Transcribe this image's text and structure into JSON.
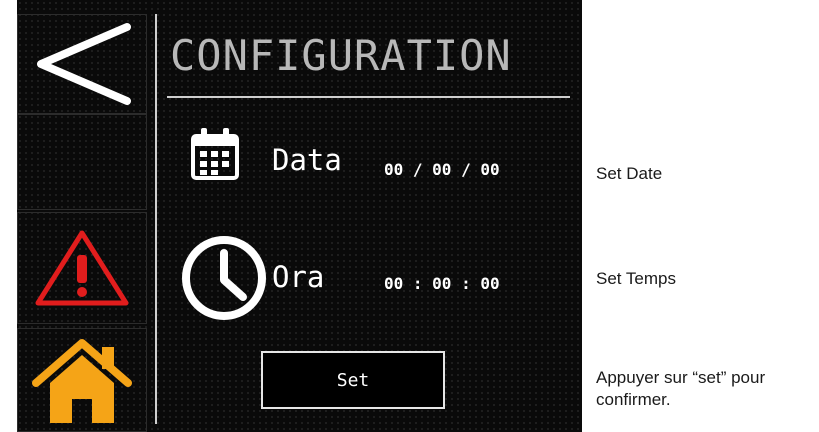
{
  "screen": {
    "title": "CONFIGURATION",
    "date_label": "Data",
    "date_value": "00 / 00 / 00",
    "time_label": "Ora",
    "time_value": "00 : 00 : 00",
    "set_button": "Set"
  },
  "sidebar": {
    "items": [
      {
        "icon": "back-arrow-icon"
      },
      {
        "icon": "empty"
      },
      {
        "icon": "warning-icon"
      },
      {
        "icon": "home-icon"
      }
    ]
  },
  "notes": {
    "set_date": "Set Date",
    "set_time": "Set Temps",
    "confirm_line1": "Appuyer sur “set” pour",
    "confirm_line2": "confirmer."
  },
  "colors": {
    "warning": "#e11d1d",
    "home": "#f5a417",
    "text": "#ffffff",
    "title": "#b8b8b8"
  }
}
